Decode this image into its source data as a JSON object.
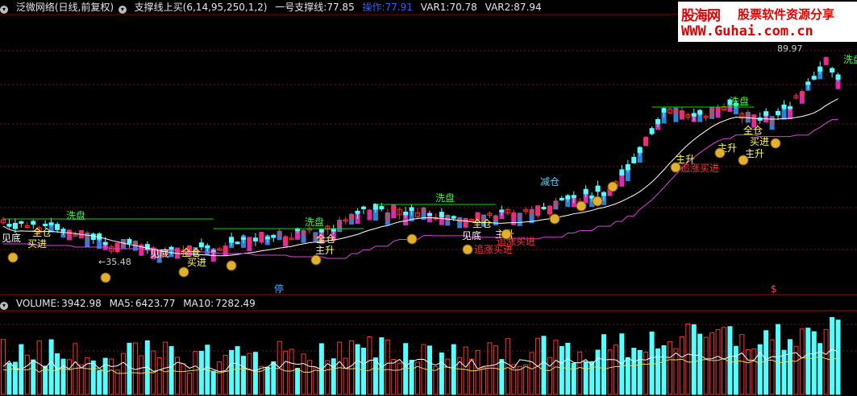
{
  "header": {
    "title": "泛微网络(日线,前复权)",
    "indicator": "支撑线上买(6,14,95,250,1,2)",
    "support_label": "一号支撑线:",
    "support_value": "77.85",
    "op_label": "操作:",
    "op_value": "77.91",
    "var1_label": "VAR1:",
    "var1_value": "70.78",
    "var2_label": "VAR2:",
    "var2_value": "87.94"
  },
  "volume_header": {
    "label": "VOLUME:",
    "value": "3942.98",
    "ma5_label": "MA5:",
    "ma5_value": "6423.77",
    "ma10_label": "MA10:",
    "ma10_value": "7282.49"
  },
  "logo": {
    "line1": "股海网",
    "line1b": "股票软件资源分享",
    "line2": "WWW.Guhai.com.cn"
  },
  "chart_data": {
    "type": "candlestick",
    "price_high_label": "89.97",
    "price_low_label": "35.48",
    "ticker_marks": [
      "停",
      "$"
    ],
    "colors": {
      "up": "#ff3232",
      "down": "#54ffff",
      "support_line": "#00dd00",
      "ma_line": "#ffffff",
      "lower_line": "#e040e0",
      "ribbon_a": "#ff33cc",
      "ribbon_b": "#3399ff",
      "signal_text": "#ffff66",
      "washout_text": "#33ff33",
      "chase_text": "#ff3333"
    },
    "annotations": [
      {
        "text": "见底",
        "color": "#ffffff"
      },
      {
        "text": "全仓",
        "color": "#ffff66"
      },
      {
        "text": "买进",
        "color": "#ffff66"
      },
      {
        "text": "洗盘",
        "color": "#33ff33"
      },
      {
        "text": "见底",
        "color": "#ffffff"
      },
      {
        "text": "全仓",
        "color": "#ffff66"
      },
      {
        "text": "买进",
        "color": "#ffff66"
      },
      {
        "text": "洗盘",
        "color": "#33ff33"
      },
      {
        "text": "全仓",
        "color": "#ffff66"
      },
      {
        "text": "主升",
        "color": "#ffff66"
      },
      {
        "text": "洗盘",
        "color": "#33ff33"
      },
      {
        "text": "全仓",
        "color": "#ffff66"
      },
      {
        "text": "见底",
        "color": "#ffffff"
      },
      {
        "text": "主升",
        "color": "#ffff66"
      },
      {
        "text": "追涨买进",
        "color": "#ff3333"
      },
      {
        "text": "追涨买进",
        "color": "#ff3333"
      },
      {
        "text": "减仓",
        "color": "#66ccff"
      },
      {
        "text": "主升",
        "color": "#ffff66"
      },
      {
        "text": "追涨买进",
        "color": "#ff3333"
      },
      {
        "text": "主升",
        "color": "#ffff66"
      },
      {
        "text": "洗盘",
        "color": "#33ff33"
      },
      {
        "text": "全仓",
        "color": "#ffff66"
      },
      {
        "text": "买进",
        "color": "#ffff66"
      },
      {
        "text": "主升",
        "color": "#ffff66"
      },
      {
        "text": "洗盘",
        "color": "#33ff33"
      }
    ]
  }
}
